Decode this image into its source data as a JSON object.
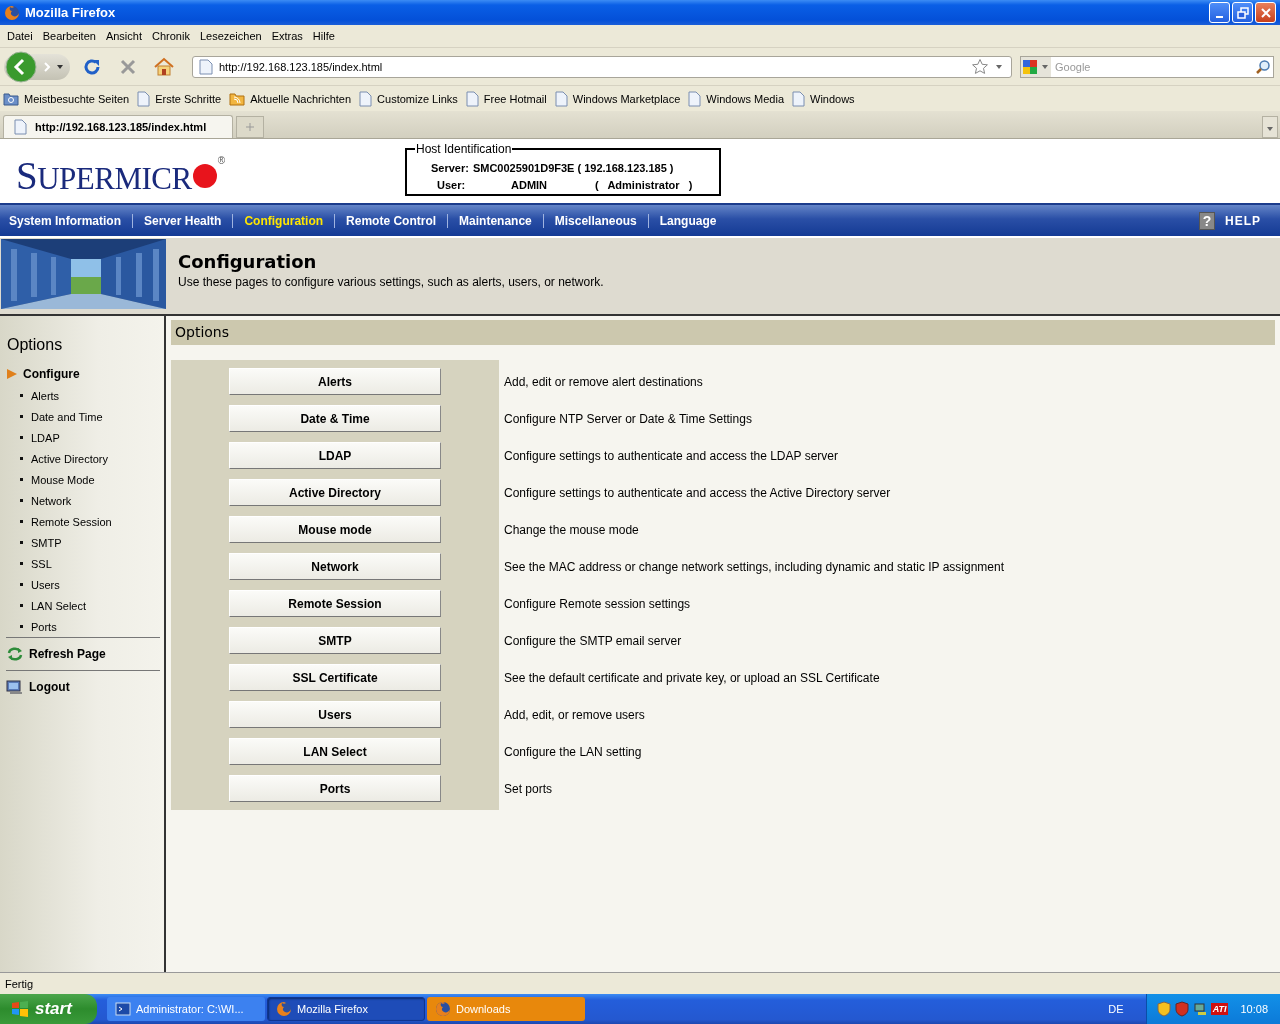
{
  "window": {
    "title": "Mozilla Firefox"
  },
  "menu_bar": [
    "Datei",
    "Bearbeiten",
    "Ansicht",
    "Chronik",
    "Lesezeichen",
    "Extras",
    "Hilfe"
  ],
  "toolbar": {
    "address": "http://192.168.123.185/index.html",
    "search_placeholder": "Google"
  },
  "bookmarks": [
    {
      "label": "Meistbesuchte Seiten",
      "kind": "folder"
    },
    {
      "label": "Erste Schritte",
      "kind": "page"
    },
    {
      "label": "Aktuelle Nachrichten",
      "kind": "feed"
    },
    {
      "label": "Customize Links",
      "kind": "page"
    },
    {
      "label": "Free Hotmail",
      "kind": "page"
    },
    {
      "label": "Windows Marketplace",
      "kind": "page"
    },
    {
      "label": "Windows Media",
      "kind": "page"
    },
    {
      "label": "Windows",
      "kind": "page"
    }
  ],
  "tabs": [
    {
      "label": "http://192.168.123.185/index.html",
      "selected": true
    }
  ],
  "page": {
    "logo": {
      "text": "SUPERMICR",
      "mark": "®"
    },
    "host_identification": {
      "title": "Host Identification",
      "server_label": "Server:",
      "server_value": "SMC0025901D9F3E ( 192.168.123.185 )",
      "user_label": "User:",
      "user_name": "ADMIN",
      "user_role": "(   Administrator   )"
    },
    "nav": [
      {
        "label": "System Information",
        "selected": false
      },
      {
        "label": "Server Health",
        "selected": false
      },
      {
        "label": "Configuration",
        "selected": true
      },
      {
        "label": "Remote Control",
        "selected": false
      },
      {
        "label": "Maintenance",
        "selected": false
      },
      {
        "label": "Miscellaneous",
        "selected": false
      },
      {
        "label": "Language",
        "selected": false
      }
    ],
    "help": {
      "icon": "?",
      "label": "HELP"
    },
    "banner": {
      "title": "Configuration",
      "description": "Use these pages to configure various settings, such as alerts, users, or network."
    },
    "sidebar": {
      "title": "Options",
      "group": "Configure",
      "items": [
        "Alerts",
        "Date and Time",
        "LDAP",
        "Active Directory",
        "Mouse Mode",
        "Network",
        "Remote Session",
        "SMTP",
        "SSL",
        "Users",
        "LAN Select",
        "Ports"
      ],
      "actions": [
        {
          "label": "Refresh Page",
          "kind": "refresh"
        },
        {
          "label": "Logout",
          "kind": "logout"
        }
      ]
    },
    "content": {
      "title": "Options",
      "options": [
        {
          "button": "Alerts",
          "description": "Add, edit or remove alert destinations"
        },
        {
          "button": "Date & Time",
          "description": "Configure NTP Server or Date & Time Settings"
        },
        {
          "button": "LDAP",
          "description": "Configure settings to authenticate and access the LDAP server"
        },
        {
          "button": "Active Directory",
          "description": "Configure settings to authenticate and access the Active Directory server"
        },
        {
          "button": "Mouse mode",
          "description": "Change the mouse mode"
        },
        {
          "button": "Network",
          "description": "See the MAC address or change network settings, including dynamic and static IP assignment"
        },
        {
          "button": "Remote Session",
          "description": "Configure Remote session settings"
        },
        {
          "button": "SMTP",
          "description": "Configure the SMTP email server"
        },
        {
          "button": "SSL Certificate",
          "description": "See the default certificate and private key, or upload an SSL Certificate"
        },
        {
          "button": "Users",
          "description": "Add, edit, or remove users"
        },
        {
          "button": "LAN Select",
          "description": "Configure the LAN setting"
        },
        {
          "button": "Ports",
          "description": "Set ports"
        }
      ]
    }
  },
  "status_bar": "Fertig",
  "taskbar": {
    "start": "start",
    "items": [
      {
        "label": "Administrator: C:\\WI...",
        "kind": "console",
        "selected": false,
        "attention": false
      },
      {
        "label": "Mozilla Firefox",
        "kind": "firefox",
        "selected": true,
        "attention": false
      },
      {
        "label": "Downloads",
        "kind": "firefox",
        "selected": false,
        "attention": true
      }
    ],
    "language": "DE",
    "tray_label": "ATI",
    "clock": "10:08"
  }
}
